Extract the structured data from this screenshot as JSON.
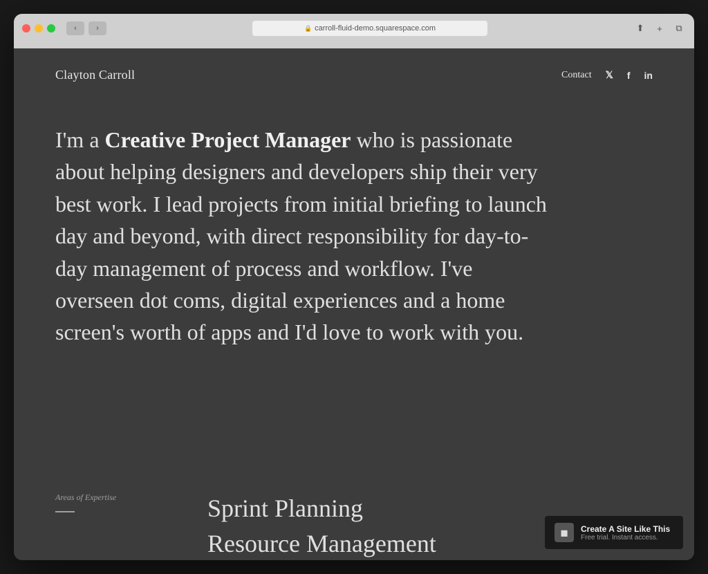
{
  "browser": {
    "url": "carroll-fluid-demo.squarespace.com",
    "nav": {
      "back": "‹",
      "forward": "›"
    },
    "actions": {
      "share": "⬆",
      "new_tab": "+",
      "windows": "⧉"
    }
  },
  "site": {
    "logo": "Clayton Carroll",
    "nav": {
      "contact_label": "Contact",
      "twitter_icon": "𝕏",
      "facebook_icon": "f",
      "linkedin_icon": "in"
    },
    "hero": {
      "text_before_bold": "I'm a ",
      "bold_text": "Creative Project Manager",
      "text_after": " who is passionate about helping designers and developers ship their very best work. I lead projects from initial briefing to launch day and beyond, with direct responsibility for day-to-day management of process and workflow. I've overseen dot coms, digital experiences and a home screen's worth of apps and I'd love to work with you."
    },
    "expertise": {
      "label": "Areas of Expertise",
      "items": [
        "Sprint Planning",
        "Resource Management"
      ]
    }
  },
  "squarespace_banner": {
    "logo_text": "◼",
    "title": "Create A Site Like This",
    "subtitle": "Free trial. Instant access."
  }
}
